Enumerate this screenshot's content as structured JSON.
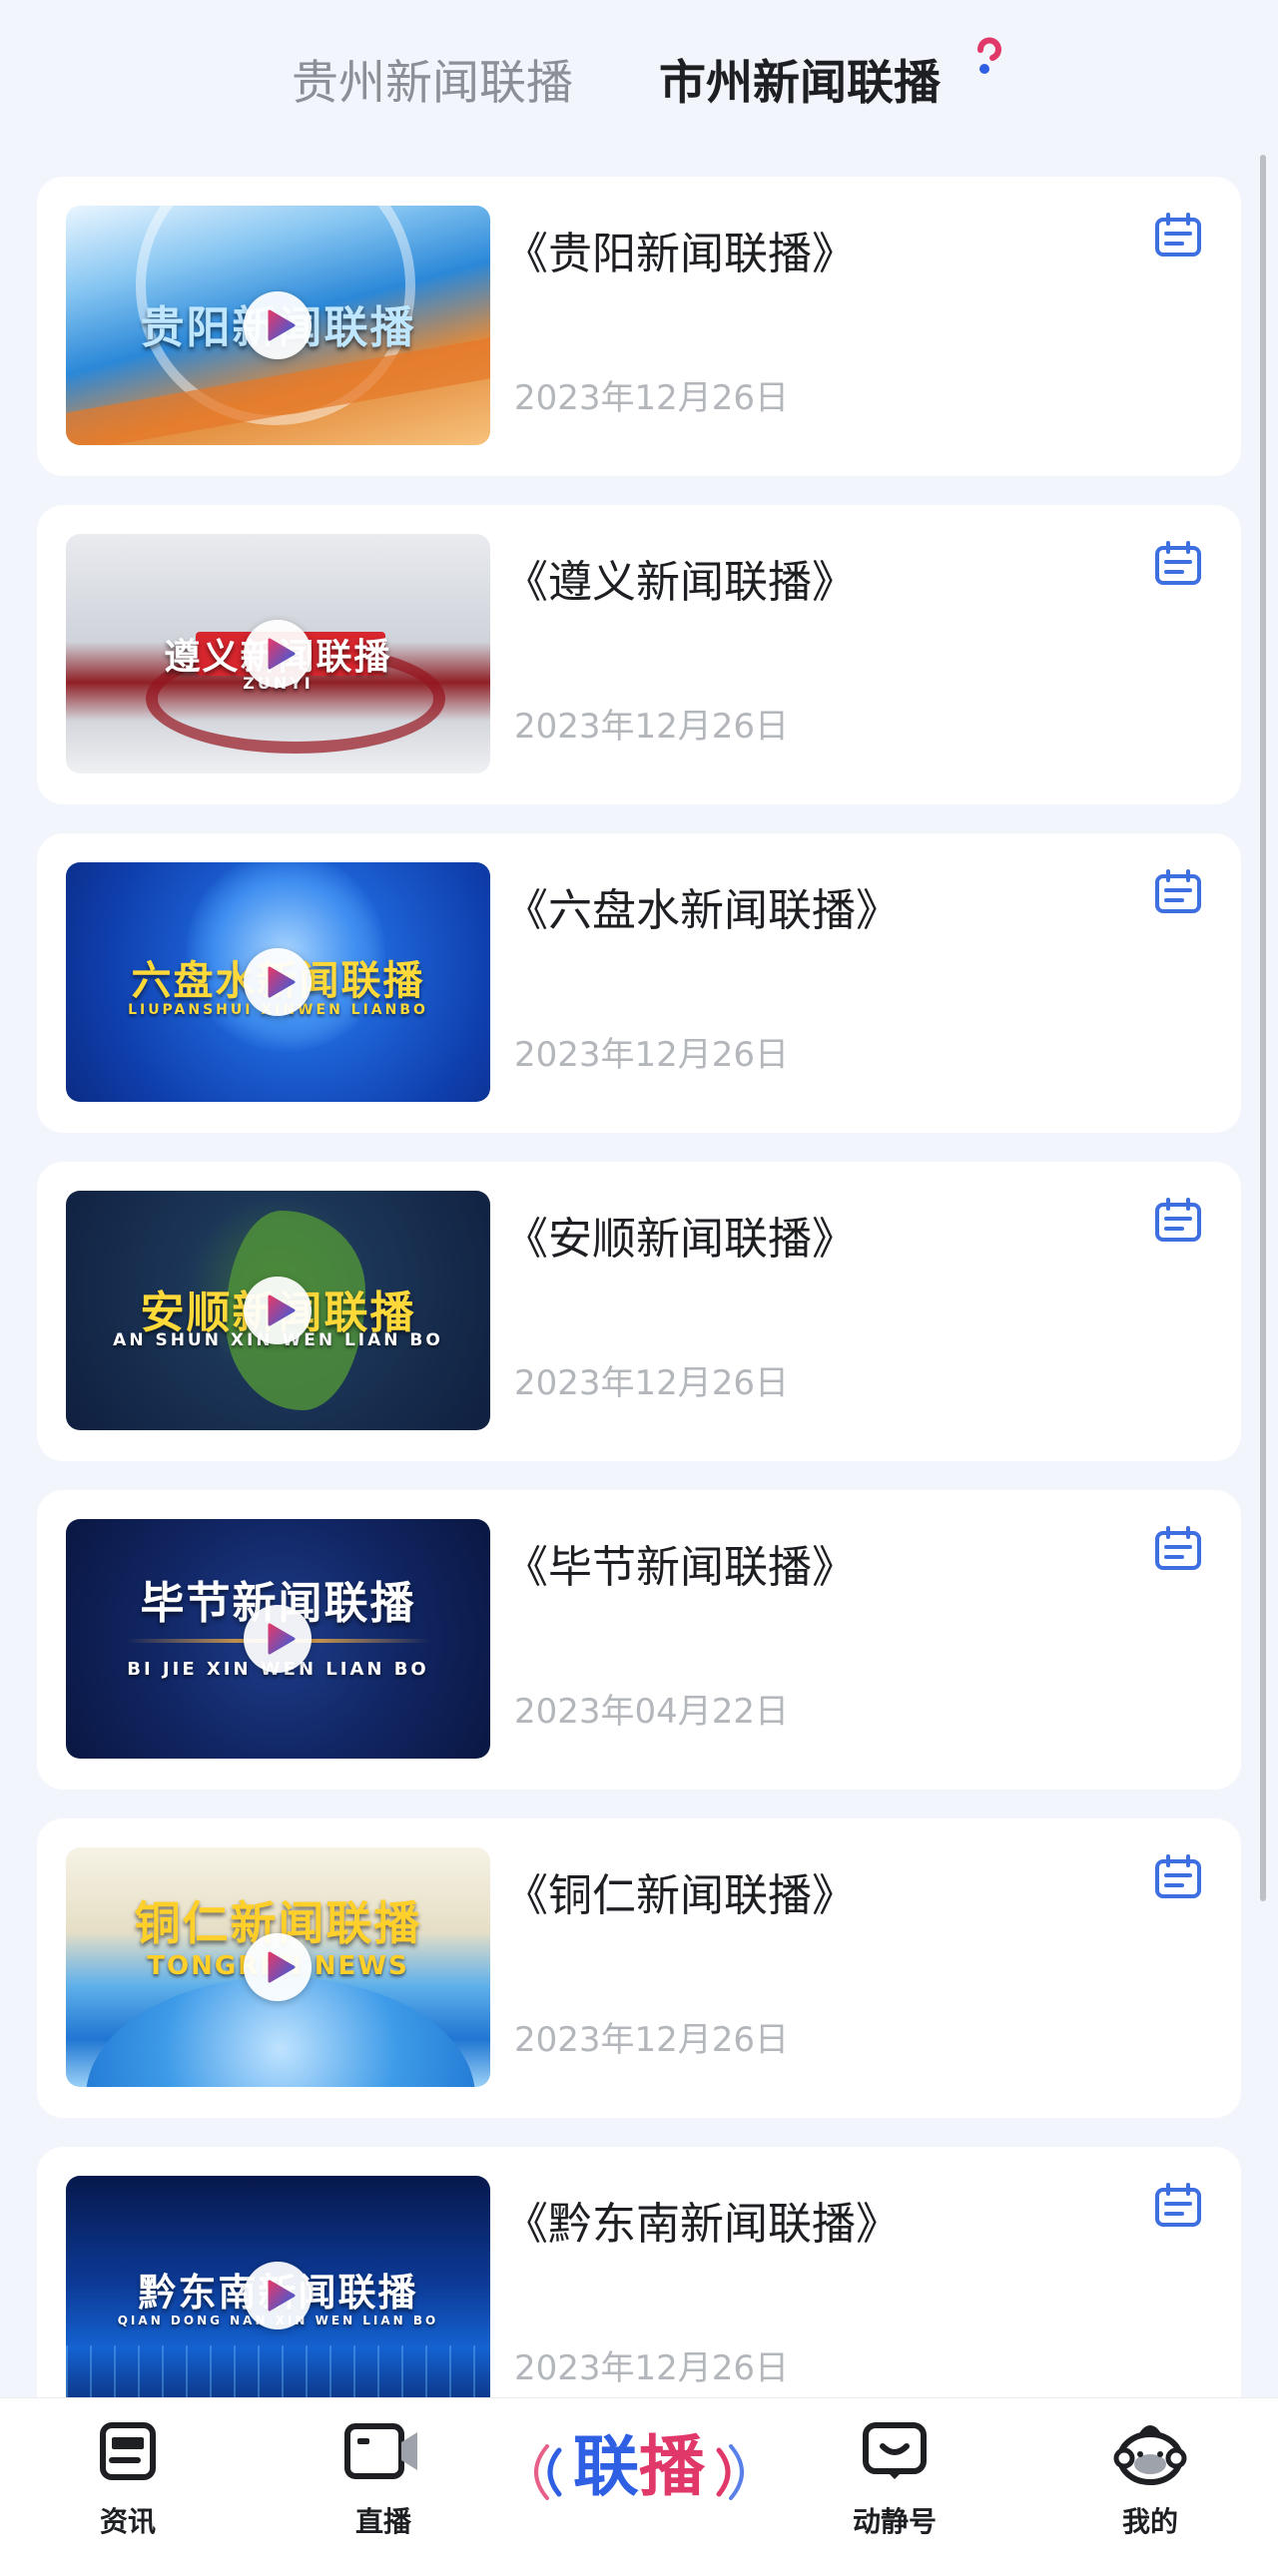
{
  "tabs": {
    "inactive_label": "贵州新闻联播",
    "active_label": "市州新闻联播"
  },
  "items": [
    {
      "title": "《贵阳新闻联播》",
      "date": "2023年12月26日",
      "thumb_text": "贵阳新闻联播",
      "thumb_sub": ""
    },
    {
      "title": "《遵义新闻联播》",
      "date": "2023年12月26日",
      "thumb_text": "遵义新闻联播",
      "thumb_sub": "ZUNYI"
    },
    {
      "title": "《六盘水新闻联播》",
      "date": "2023年12月26日",
      "thumb_text": "六盘水新闻联播",
      "thumb_sub": "LIUPANSHUI XINWEN LIANBO"
    },
    {
      "title": "《安顺新闻联播》",
      "date": "2023年12月26日",
      "thumb_text": "安顺新闻联播",
      "thumb_sub": "AN SHUN XIN WEN LIAN BO"
    },
    {
      "title": "《毕节新闻联播》",
      "date": "2023年04月22日",
      "thumb_text": "毕节新闻联播",
      "thumb_sub": "BI JIE XIN WEN LIAN BO"
    },
    {
      "title": "《铜仁新闻联播》",
      "date": "2023年12月26日",
      "thumb_text": "铜仁新闻联播",
      "thumb_sub": "TONGREN NEWS"
    },
    {
      "title": "《黔东南新闻联播》",
      "date": "2023年12月26日",
      "thumb_text": "黔东南新闻联播",
      "thumb_sub": "QIAN DONG NAN XIN WEN LIAN BO"
    }
  ],
  "bottom_nav": {
    "news": "资讯",
    "live": "直播",
    "center_part1": "联",
    "center_part2": "播",
    "dongjing": "动静号",
    "mine": "我的"
  },
  "colors": {
    "accent_blue": "#2f5fe3",
    "accent_pink": "#e1386a",
    "icon_blue": "#3d6fe0",
    "date_gray": "#b3b6bb"
  },
  "icons": [
    "play-icon",
    "schedule-list-icon",
    "news-icon",
    "live-icon",
    "dongjing-icon",
    "mine-icon"
  ]
}
